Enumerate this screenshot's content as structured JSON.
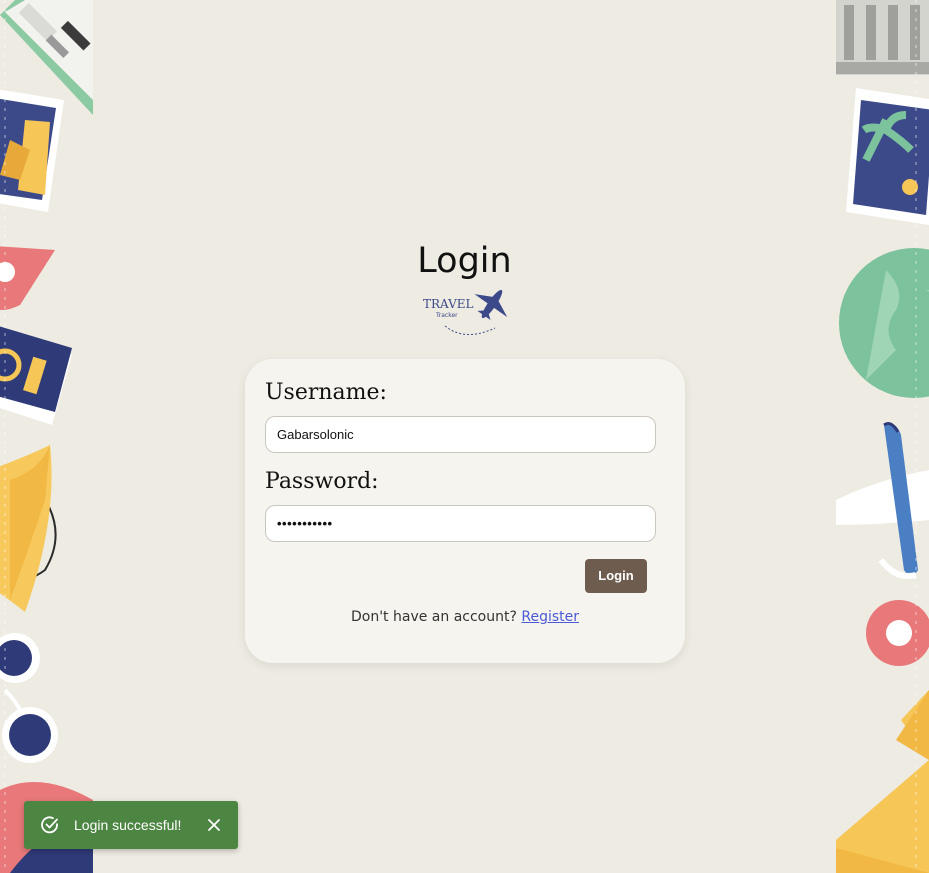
{
  "header": {
    "title": "Login",
    "logo": {
      "name": "travel-tracker-logo",
      "text_main": "TRAVEL",
      "text_sub": "Tracker"
    }
  },
  "form": {
    "username_label": "Username:",
    "username_value": "Gabarsolonic",
    "password_label": "Password:",
    "password_value": "•••••••••••",
    "login_button": "Login",
    "register_prompt": "Don't have an account?",
    "register_link": "Register"
  },
  "toast": {
    "message": "Login successful!",
    "icon": "check-circle-icon",
    "close_icon": "close-icon",
    "color": "#4d8543"
  },
  "colors": {
    "background": "#eeebe2",
    "card": "#f6f4ee",
    "button": "#6e5d4f",
    "link": "#4a5ad6"
  }
}
